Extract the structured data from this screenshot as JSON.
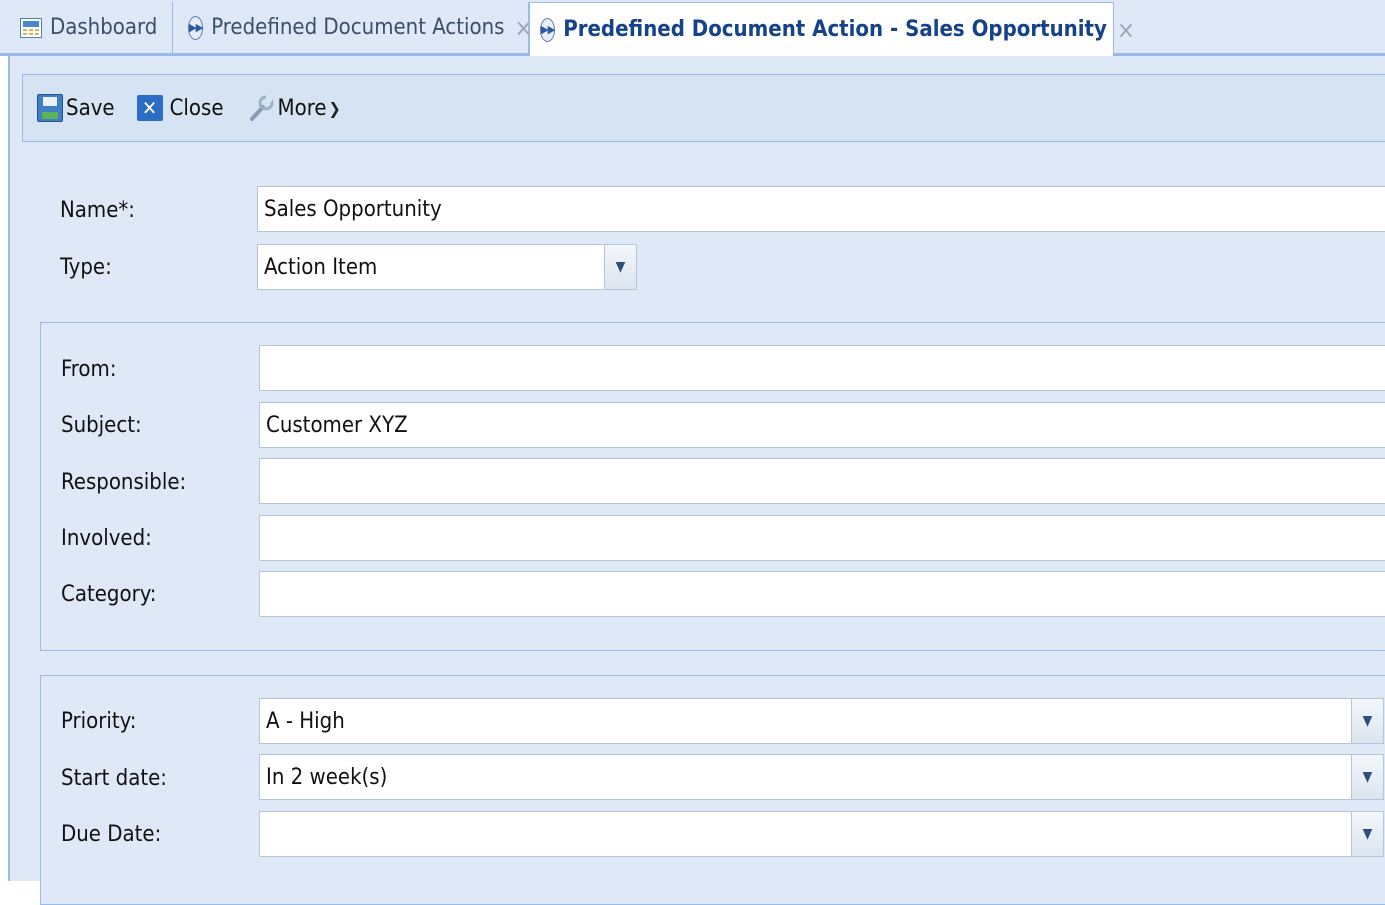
{
  "tabs": [
    {
      "label": "Dashboard",
      "icon": "dashboard-grid-icon",
      "closable": false,
      "active": false
    },
    {
      "label": "Predefined Document Actions",
      "icon": "play-circle-icon",
      "closable": true,
      "active": false
    },
    {
      "label": "Predefined Document Action - Sales Opportunity",
      "icon": "play-circle-icon",
      "closable": true,
      "active": true
    }
  ],
  "tab_close_glyph": "×",
  "toolbar": {
    "save_label": "Save",
    "close_label": "Close",
    "more_label": "More"
  },
  "form": {
    "name": {
      "label": "Name*:",
      "value": "Sales Opportunity"
    },
    "type": {
      "label": "Type:",
      "value": "Action Item"
    },
    "from": {
      "label": "From:",
      "value": ""
    },
    "subject": {
      "label": "Subject:",
      "value": "Customer XYZ"
    },
    "responsible": {
      "label": "Responsible:",
      "value": ""
    },
    "involved": {
      "label": "Involved:",
      "value": ""
    },
    "category": {
      "label": "Category:",
      "value": ""
    },
    "priority": {
      "label": "Priority:",
      "value": "A - High"
    },
    "start_date": {
      "label": "Start date:",
      "value": "In 2 week(s)"
    },
    "due_date": {
      "label": "Due Date:",
      "value": ""
    }
  },
  "colors": {
    "panel_bg": "#dfe8f6",
    "border": "#99bbe8",
    "active_tab_text": "#15428b"
  }
}
